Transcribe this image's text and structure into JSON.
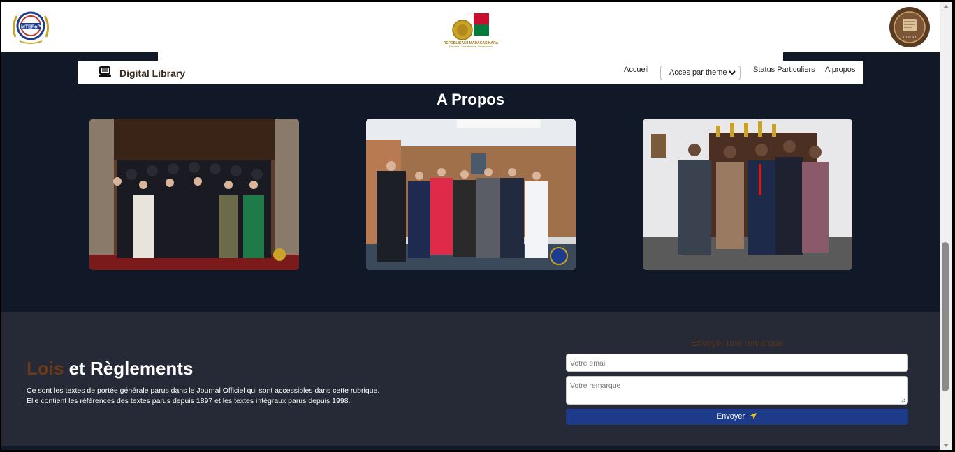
{
  "header": {
    "logo_left_text": "MTEFoP",
    "logo_center_text": "REPOBLIKAN'I MADAGASIKARA",
    "logo_center_motto": "Fitiavana - Tanindrazana - Fandrosoana",
    "logo_right_text": "CDEAJ"
  },
  "navbar": {
    "brand": "Digital Library",
    "links": {
      "accueil": "Accueil",
      "select_value": "Acces par theme",
      "status": "Status Particuliers",
      "apropos": "A propos"
    }
  },
  "section": {
    "title": "A Propos"
  },
  "footer": {
    "title_accent": "Lois",
    "title_rest": " et Règlements",
    "line1": "Ce sont les textes de portée générale parus dans le Journal Officiel qui sont accessibles dans cette rubrique.",
    "line2": "Elle contient les références des textes parus depuis 1897 et les textes intégraux parus depuis 1998.",
    "form_title": "Envoyer une remarque",
    "email_placeholder": "Votre email",
    "remark_placeholder": "Votre remarque",
    "send_label": "Envoyer"
  },
  "icons": {
    "brand": "computer-icon",
    "send": "paper-plane-icon",
    "select": "chevron-down-icon"
  },
  "colors": {
    "page_bg": "#111827",
    "footer_bg": "#252a36",
    "accent_brown": "#6b3a18",
    "button_blue": "#1e3a8a"
  }
}
